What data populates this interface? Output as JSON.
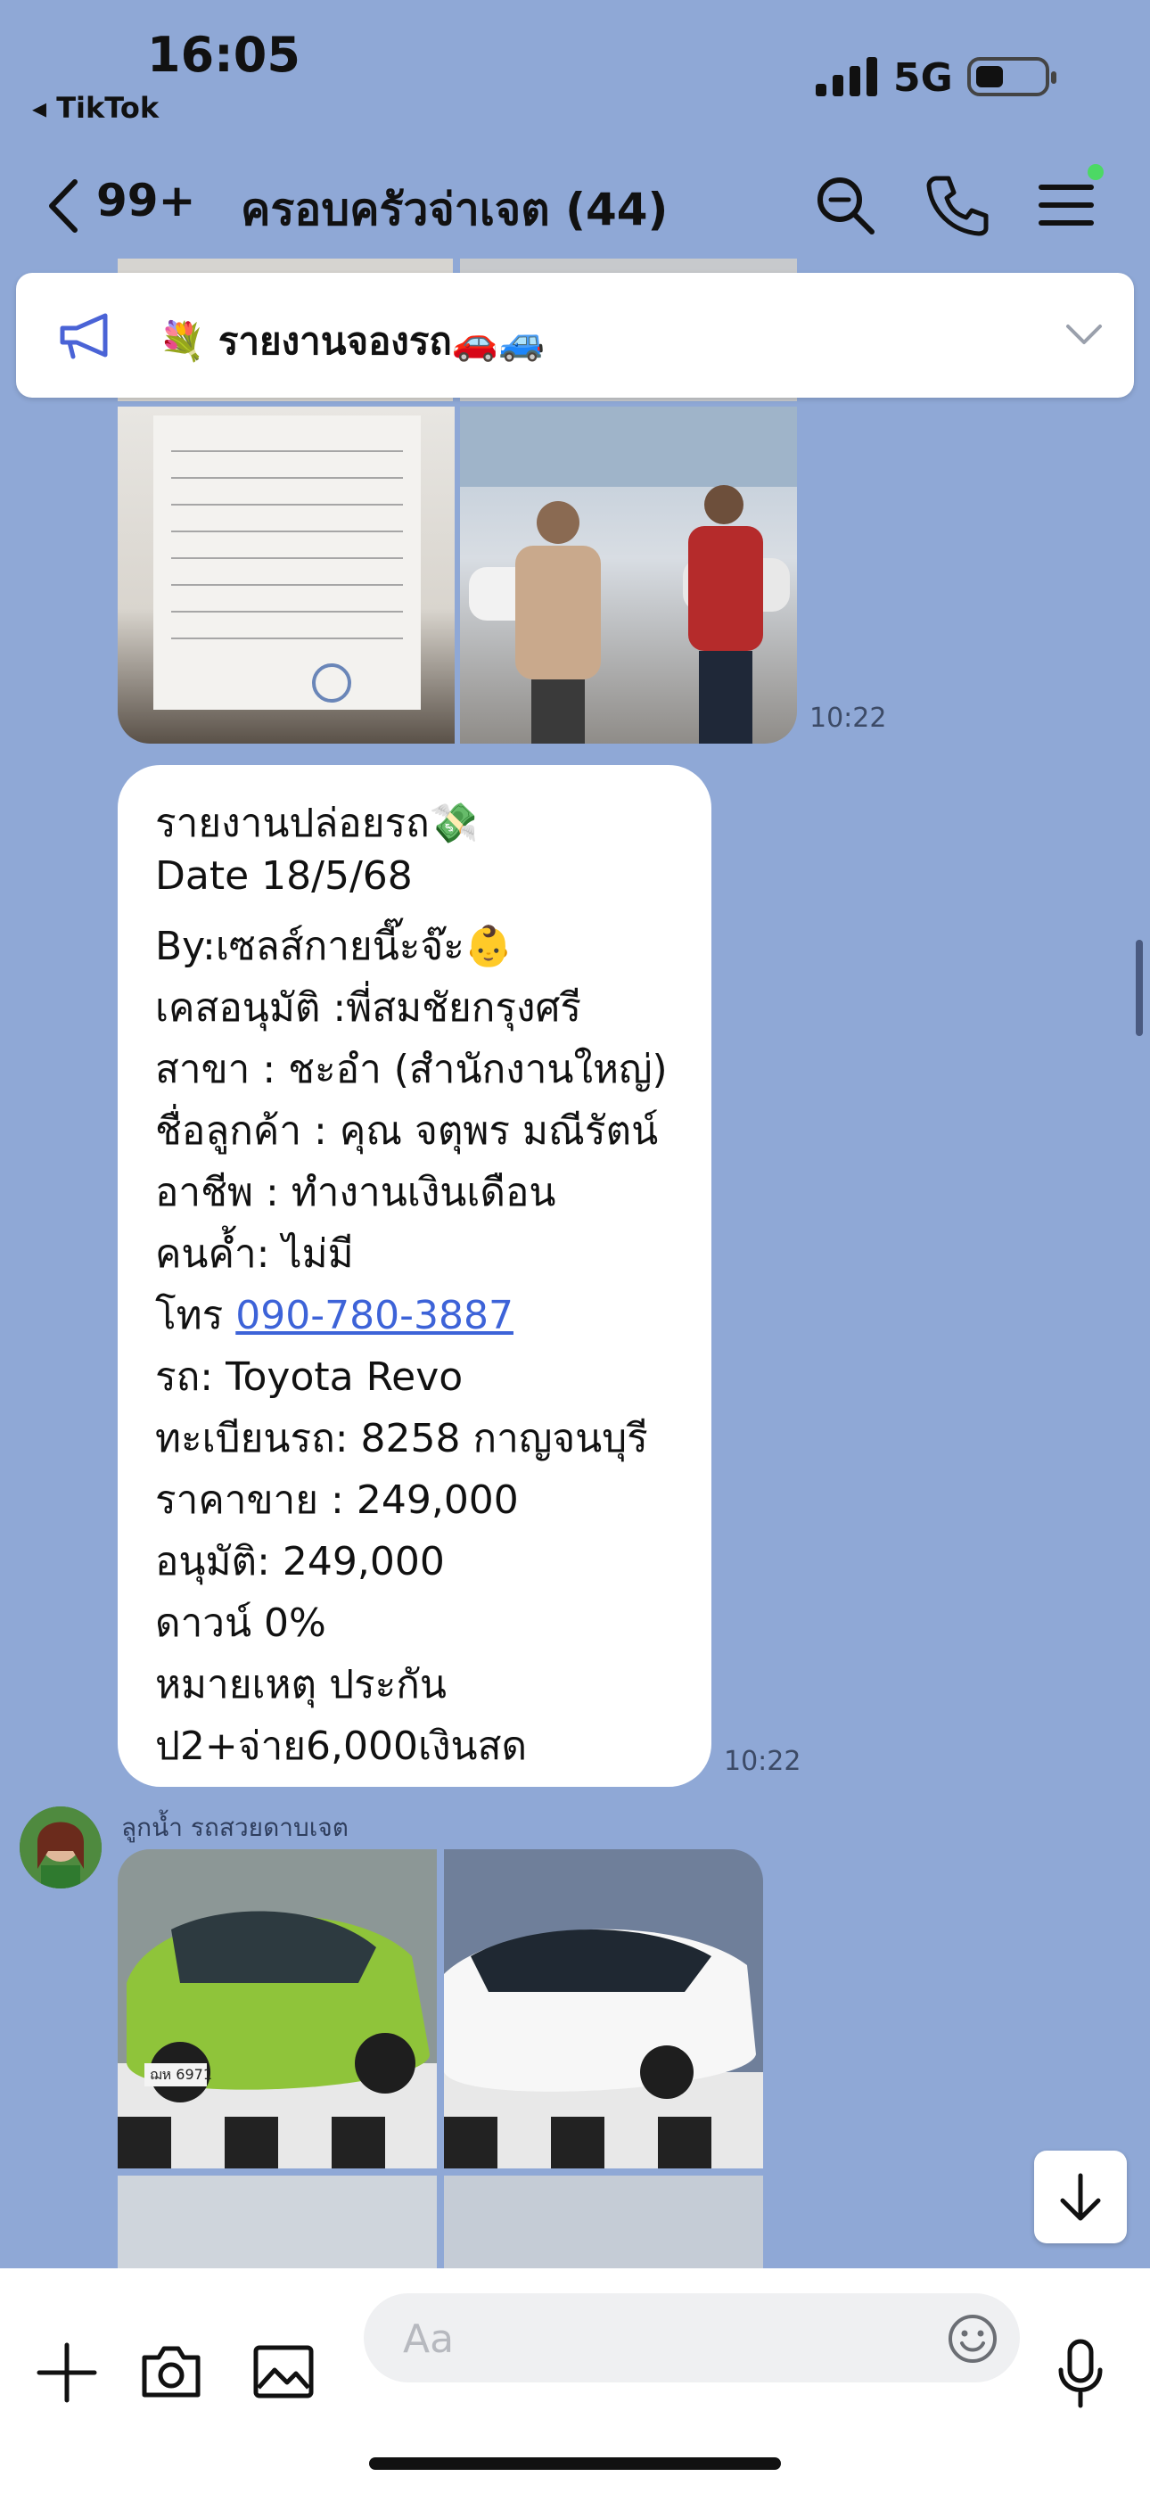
{
  "status_bar": {
    "time": "16:05",
    "back_app": "◂ TikTok",
    "network": "5G"
  },
  "header": {
    "unread_count": "99+",
    "title": "ครอบครัวจ่าเจต (44)",
    "icons": [
      "back-chevron-icon",
      "search-icon",
      "phone-icon",
      "menu-icon"
    ]
  },
  "announcement": {
    "text": "💐 รายงานจองรถ🚗🚙",
    "icon": "megaphone-icon"
  },
  "messages": {
    "photo_timestamp": "10:22",
    "text_timestamp": "10:22",
    "report_lines": [
      "รายงานปล่อยรถ💸",
      "Date 18/5/68",
      "By:เซลส์กายนี๊ะจ๊ะ👶",
      "เคสอนุมัติ :พี่สมชัยกรุงศรี",
      "สาขา : ชะอำ (สำนักงานใหญ่)",
      "ชื่อลูกค้า : คุณ  จตุพร มณีรัตน์",
      "อาชีพ : ทำงานเงินเดือน",
      "คนค้ำ: ไม่มี"
    ],
    "phone_label": "โทร ",
    "phone_number": "090-780-3887",
    "report_lines_after": [
      "รถ: Toyota Revo",
      "ทะเบียนรถ: 8258 กาญจนบุรี",
      "ราคาขาย : 249,000",
      "อนุมัติ:  249,000",
      "ดาวน์ 0%",
      "หมายเหตุ ประกัน",
      "ป2+จ่าย6,000เงินสด"
    ],
    "sender_name": "ลูกน้ำ รถสวยดาบเจต",
    "plate_text": "ฌห 6971"
  },
  "composer": {
    "placeholder": "Aa"
  },
  "colors": {
    "chat_background": "#8fa8d6",
    "link": "#3d63d8",
    "online_dot": "#4cd964"
  }
}
